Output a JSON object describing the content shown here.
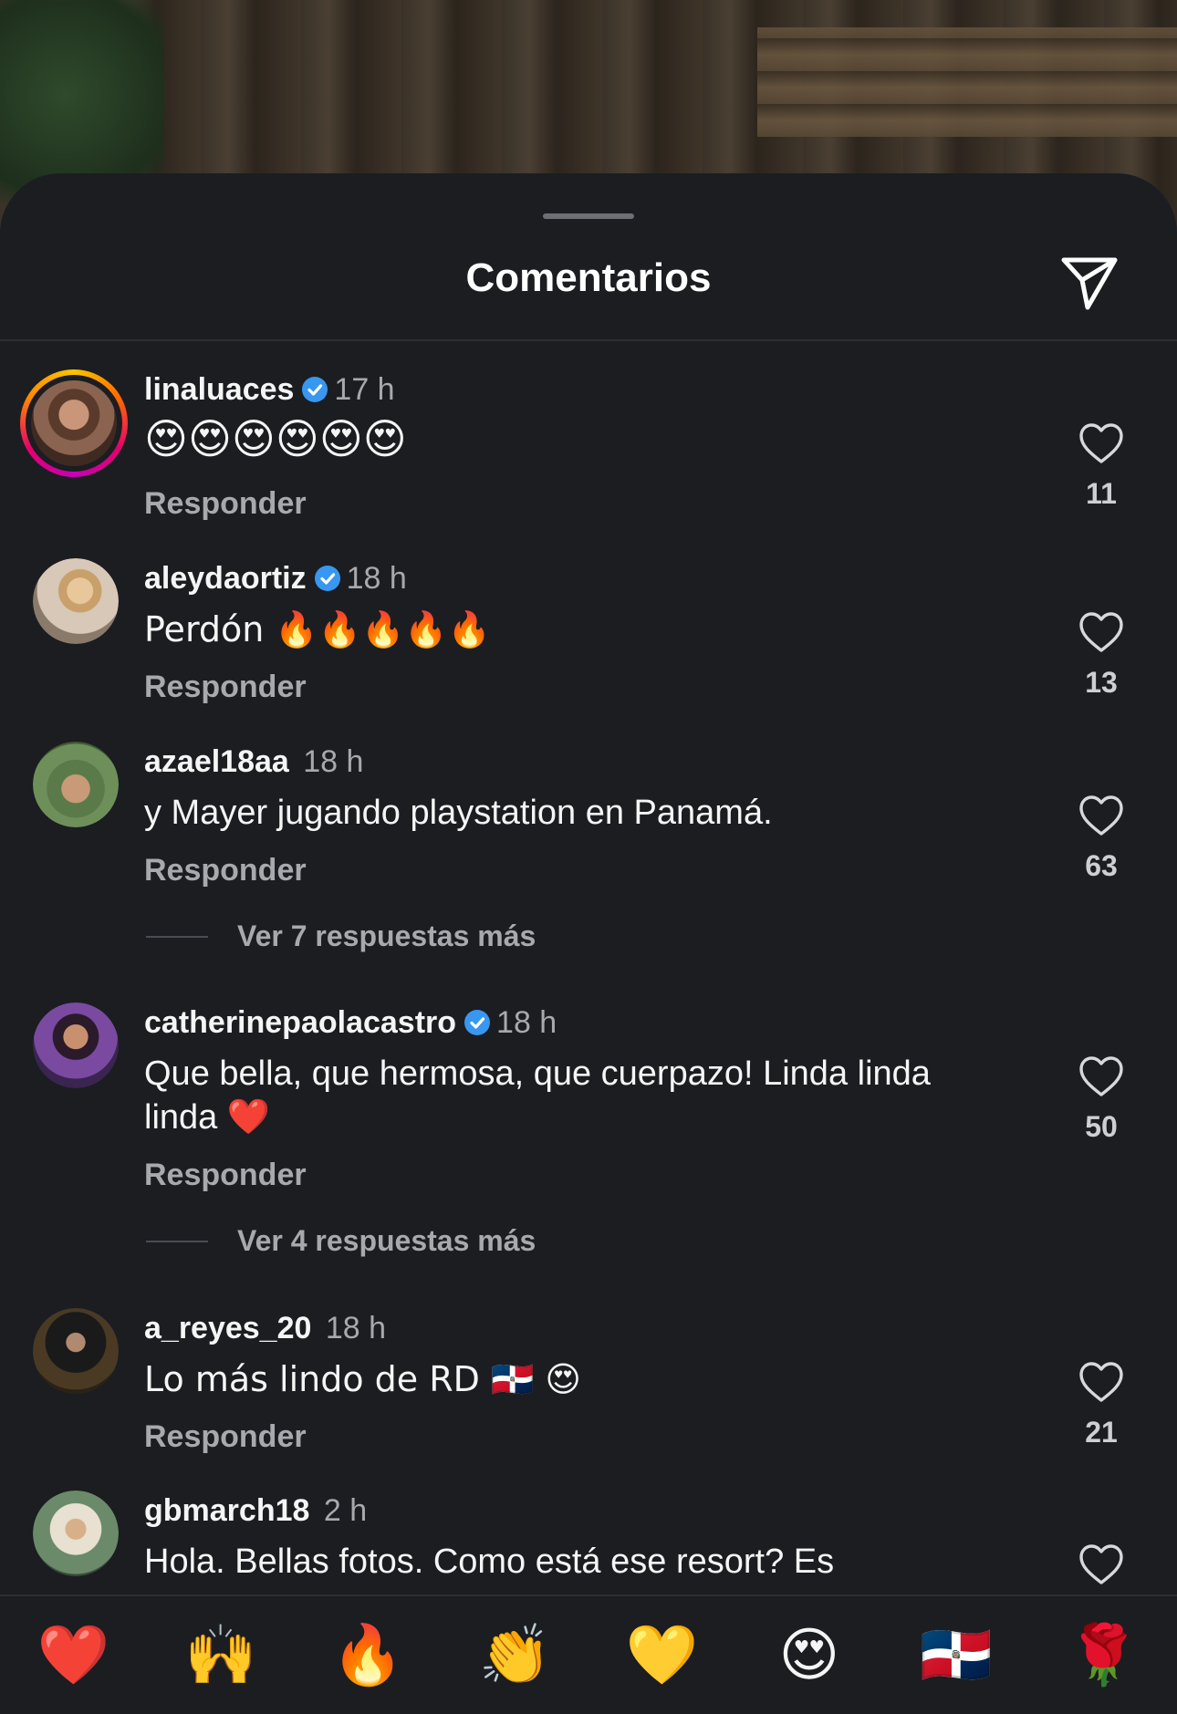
{
  "header": {
    "title": "Comentarios"
  },
  "comments": [
    {
      "username": "linaluaces",
      "verified": true,
      "time": "17 h",
      "text": "😍😍😍😍😍😍",
      "reply_label": "Responder",
      "likes": "11"
    },
    {
      "username": "aleydaortiz",
      "verified": true,
      "time": "18 h",
      "text": "Perdón 🔥🔥🔥🔥🔥",
      "reply_label": "Responder",
      "likes": "13"
    },
    {
      "username": "azael18aa",
      "verified": false,
      "time": "18 h",
      "text": "y Mayer jugando playstation en Panamá.",
      "reply_label": "Responder",
      "likes": "63",
      "more_replies": "Ver 7 respuestas más"
    },
    {
      "username": "catherinepaolacastro",
      "verified": true,
      "time": "18 h",
      "text": "Que bella, que hermosa, que cuerpazo! Linda linda linda ❤️",
      "reply_label": "Responder",
      "likes": "50",
      "more_replies": "Ver 4 respuestas más"
    },
    {
      "username": "a_reyes_20",
      "verified": false,
      "time": "18 h",
      "text": "Lo más lindo de RD 🇩🇴 😍",
      "reply_label": "Responder",
      "likes": "21"
    },
    {
      "username": "gbmarch18",
      "verified": false,
      "time": "2 h",
      "text": "Hola. Bellas fotos. Como está ese resort? Es",
      "likes": ""
    }
  ],
  "emoji_bar": [
    "❤️",
    "🙌",
    "🔥",
    "👏",
    "💛",
    "😍",
    "🇩🇴",
    "🌹"
  ],
  "colors": {
    "sheet_bg": "#1b1d21",
    "verified_blue": "#3897f0",
    "secondary_text": "#a8a8ad"
  },
  "icons": {
    "share": "paper-plane-icon",
    "like": "heart-outline-icon",
    "verified": "verified-badge-icon"
  }
}
